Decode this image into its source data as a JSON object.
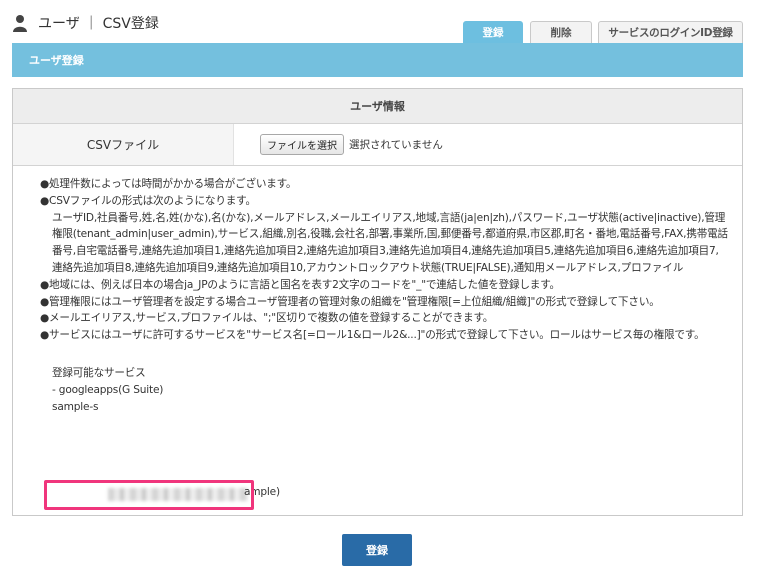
{
  "header": {
    "title": "ユーザ ｜ CSV登録",
    "icon": "user-icon"
  },
  "tabs": [
    {
      "label": "登録",
      "active": true
    },
    {
      "label": "削除",
      "active": false
    },
    {
      "label": "サービスのログインID登録",
      "active": false
    }
  ],
  "section_title": "ユーザ登録",
  "panel": {
    "title": "ユーザ情報",
    "csv_label": "CSVファイル",
    "file_button": "ファイルを選択",
    "file_status": "選択されていません"
  },
  "notes": {
    "note1": "●処理件数によっては時間がかかる場合がございます。",
    "note2": "●CSVファイルの形式は次のようになります。",
    "note2_detail": "ユーザID,社員番号,姓,名,姓(かな),名(かな),メールアドレス,メールエイリアス,地域,言語(ja|en|zh),パスワード,ユーザ状態(active|inactive),管理権限(tenant_admin|user_admin),サービス,組織,別名,役職,会社名,部署,事業所,国,郵便番号,都道府県,市区郡,町名・番地,電話番号,FAX,携帯電話番号,自宅電話番号,連絡先追加項目1,連絡先追加項目2,連絡先追加項目3,連絡先追加項目4,連絡先追加項目5,連絡先追加項目6,連絡先追加項目7,連絡先追加項目8,連絡先追加項目9,連絡先追加項目10,アカウントロックアウト状態(TRUE|FALSE),通知用メールアドレス,プロファイル",
    "note3": "●地域には、例えば日本の場合ja_JPのように言語と国名を表す2文字のコードを\"_\"で連結した値を登録します。",
    "note4": "●管理権限にはユーザ管理者を設定する場合ユーザ管理者の管理対象の組織を\"管理権限[=上位組織/組織]\"の形式で登録して下さい。",
    "note5": "●メールエイリアス,サービス,プロファイルは、\";\"区切りで複数の値を登録することができます。",
    "note6": "●サービスにはユーザに許可するサービスを\"サービス名[=ロール1&ロール2&...]\"の形式で登録して下さい。ロールはサービス毎の権限です。",
    "services_heading": "登録可能なサービス",
    "service1": "- googleapps(G Suite)",
    "service2_start": "sample-s",
    "service2_end": "ample)"
  },
  "submit_label": "登録",
  "colors": {
    "accent": "#74c0de",
    "tab_active": "#6dbfe0",
    "button": "#296ba7",
    "highlight": "#f0357c"
  }
}
